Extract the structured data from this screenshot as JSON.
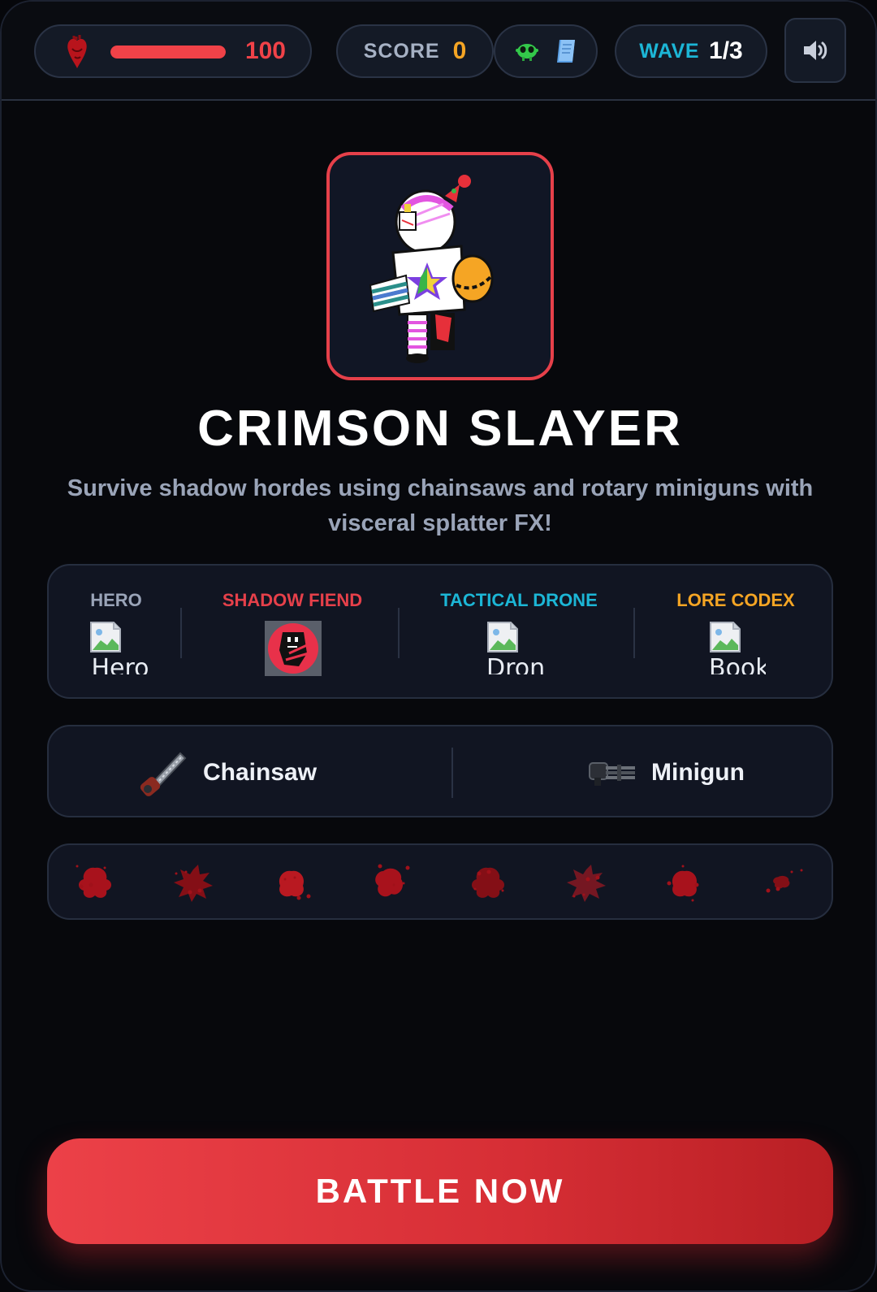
{
  "hud": {
    "health": {
      "value": "100",
      "fraction": 1.0,
      "icon": "anatomical-heart-icon"
    },
    "score": {
      "label": "SCORE",
      "value": "0"
    },
    "extras": {
      "icons": [
        "alien-icon",
        "book-icon"
      ]
    },
    "wave": {
      "label": "WAVE",
      "value": "1/3"
    },
    "sound": {
      "icon": "speaker-icon"
    }
  },
  "hero": {
    "title": "CRIMSON SLAYER",
    "subtitle": "Survive shadow hordes using chainsaws and rotary miniguns with visceral splatter FX!"
  },
  "roster": [
    {
      "label": "HERO",
      "color": "#9aa4b8",
      "alt": "Hero",
      "image": "broken-image-icon"
    },
    {
      "label": "SHADOW FIEND",
      "color": "#e6404a",
      "alt": "",
      "image": "shadow-fiend-image"
    },
    {
      "label": "TACTICAL DRONE",
      "color": "#1cb6d6",
      "alt": "Drone",
      "image": "broken-image-icon"
    },
    {
      "label": "LORE CODEX",
      "color": "#f5a524",
      "alt": "Book",
      "image": "broken-image-icon"
    }
  ],
  "weapons": [
    {
      "label": "Chainsaw",
      "icon": "chainsaw-icon"
    },
    {
      "label": "Minigun",
      "icon": "minigun-icon"
    }
  ],
  "splatter_count": 8,
  "battle": {
    "label": "BATTLE NOW"
  },
  "colors": {
    "accent": "#e6404a",
    "score": "#f5a524",
    "wave": "#1cb6d6",
    "background": "#07080c"
  }
}
